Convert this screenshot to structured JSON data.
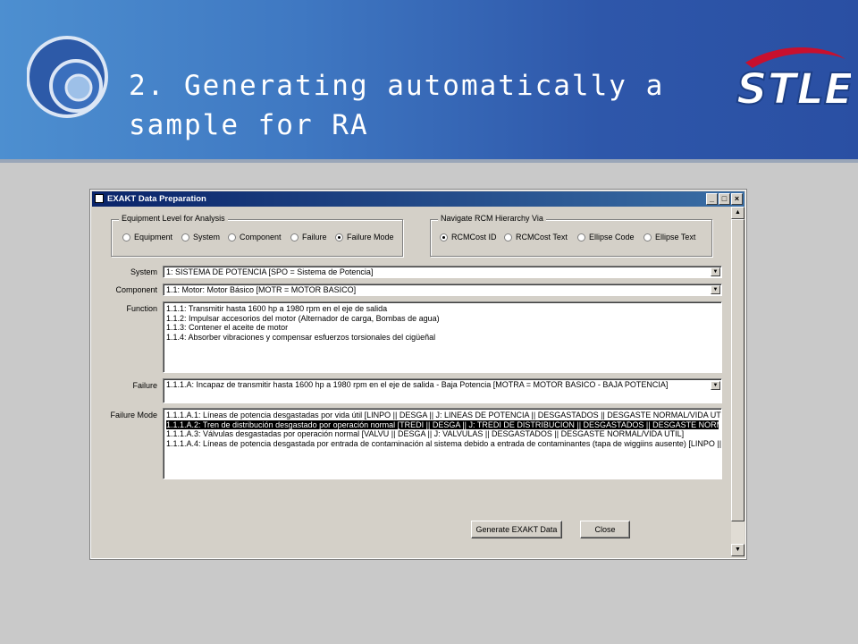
{
  "slide": {
    "title": "2. Generating automatically a\nsample for RA",
    "brand_logo": "STLE",
    "colors": {
      "banner_dark": "#2a4fa3",
      "banner_light": "#4d8fd0",
      "logo_red": "#c8102e"
    }
  },
  "window": {
    "title": "EXAKT Data Preparation",
    "buttons": {
      "minimize": "_",
      "maximize": "□",
      "close": "×"
    }
  },
  "equipment_level": {
    "legend": "Equipment Level for Analysis",
    "options": [
      "Equipment",
      "System",
      "Component",
      "Failure",
      "Failure Mode"
    ],
    "selected": "Failure Mode"
  },
  "navigate": {
    "legend": "Navigate RCM Hierarchy Via",
    "options": [
      "RCMCost ID",
      "RCMCost Text",
      "Ellipse Code",
      "Ellipse Text"
    ],
    "selected": "RCMCost ID"
  },
  "fields": {
    "system": {
      "label": "System",
      "value": "1: SISTEMA DE POTENCIA  [SPO  =  Sistema de Potencia]"
    },
    "component": {
      "label": "Component",
      "value": "1.1: Motor: Motor Básico  [MOTR  =  MOTOR BASICO]"
    },
    "function": {
      "label": "Function",
      "items": [
        "1.1.1: Transmitir hasta 1600 hp a 1980 rpm en el eje de salida",
        "1.1.2: Impulsar accesorios del motor (Alternador de carga, Bombas de agua)",
        "1.1.3: Contener el aceite de motor",
        "1.1.4: Absorber vibraciones y compensar esfuerzos torsionales del cigüeñal"
      ]
    },
    "failure": {
      "label": "Failure",
      "value": "1.1.1.A: Incapaz de transmitir hasta 1600 hp a 1980 rpm en el eje de salida - Baja Potencia  [MOTRA  =  MOTOR BASICO - BAJA POTENCIA]"
    },
    "failure_mode": {
      "label": "Failure Mode",
      "items": [
        "1.1.1.A.1: Líneas de potencia desgastadas por vida útil  [LINPO || DESGA || J:  LINEAS DE POTENCIA || DESGASTADOS || DESGASTE NORMAL/VIDA UTIL]",
        "1.1.1.A.2: Tren de distribución desgastado por operación normal  [TREDI || DESGA || J:  TREDI DE DISTRIBUCION || DESGASTADOS || DESGASTE NORMAL/VIDA UTIL]",
        "1.1.1.A.3: Válvulas desgastadas por operación normal  [VALVU || DESGA || J:  VALVULAS || DESGASTADOS || DESGASTE NORMAL/VIDA UTIL]",
        "1.1.1.A.4: Líneas de potencia desgastada por entrada de contaminación al sistema debido a entrada de contaminantes (tapa de wiggiins ausente)  [LINPO || DESGA]"
      ],
      "selected_index": 1
    }
  },
  "actions": {
    "generate": "Generate EXAKT Data",
    "close": "Close"
  }
}
